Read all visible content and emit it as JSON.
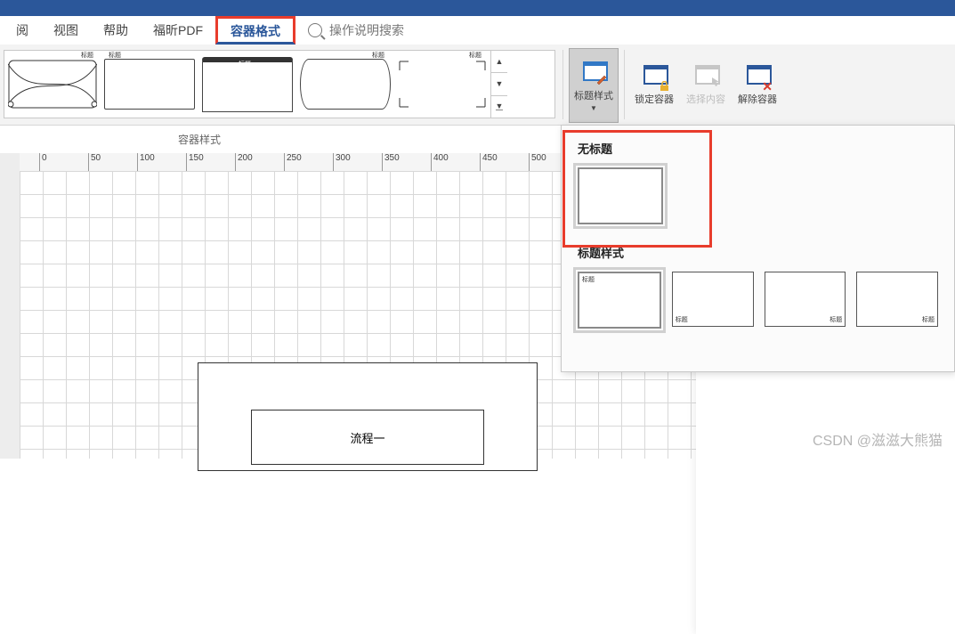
{
  "menu": {
    "items": [
      "阅",
      "视图",
      "帮助",
      "福昕PDF",
      "容器格式"
    ],
    "active_index": 4,
    "search_placeholder": "操作说明搜索"
  },
  "ribbon": {
    "group_label": "容器样式",
    "gallery_mini_label": "标题",
    "buttons": {
      "heading_style": "标题样式",
      "lock_container": "锁定容器",
      "select_content": "选择内容",
      "disband_container": "解除容器"
    }
  },
  "ruler": [
    "0",
    "50",
    "100",
    "150",
    "200",
    "250",
    "300",
    "350",
    "400",
    "450",
    "500"
  ],
  "dropdown": {
    "section_no_title": "无标题",
    "section_heading_style": "标题样式",
    "thumb_label": "标题"
  },
  "canvas": {
    "flow_label": "流程一"
  },
  "watermark": "CSDN @滋滋大熊猫"
}
